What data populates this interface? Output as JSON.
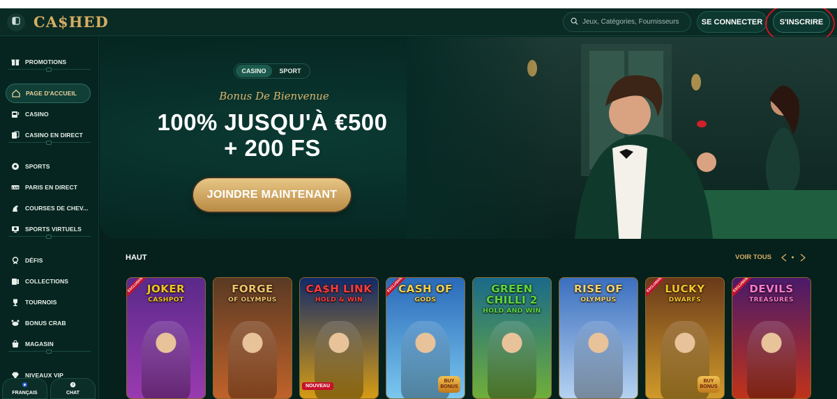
{
  "header": {
    "logo": "CA$HED",
    "search_placeholder": "Jeux, Catégories, Fournisseurs",
    "login_label": "SE CONNECTER",
    "register_label": "S'INSCRIRE"
  },
  "sidebar": {
    "items": [
      {
        "label": "PROMOTIONS",
        "icon": "gift-icon"
      },
      {
        "label": "PAGE D'ACCUEIL",
        "icon": "home-icon",
        "active": true
      },
      {
        "label": "CASINO",
        "icon": "slot-machine-icon"
      },
      {
        "label": "CASINO EN DIRECT",
        "icon": "live-cards-icon"
      },
      {
        "label": "SPORTS",
        "icon": "soccer-ball-icon"
      },
      {
        "label": "PARIS EN DIRECT",
        "icon": "live-icon"
      },
      {
        "label": "COURSES DE CHEV...",
        "icon": "horse-icon"
      },
      {
        "label": "SPORTS VIRTUELS",
        "icon": "virtual-sports-icon"
      },
      {
        "label": "DÉFIS",
        "icon": "challenge-icon"
      },
      {
        "label": "COLLECTIONS",
        "icon": "collections-icon"
      },
      {
        "label": "TOURNOIS",
        "icon": "trophy-icon"
      },
      {
        "label": "BONUS CRAB",
        "icon": "crab-icon"
      },
      {
        "label": "MAGASIN",
        "icon": "shop-icon"
      },
      {
        "label": "NIVEAUX VIP",
        "icon": "diamond-icon"
      }
    ],
    "language_label": "FRANÇAIS",
    "chat_label": "CHAT"
  },
  "hero": {
    "tab_casino": "CASINO",
    "tab_sport": "SPORT",
    "subtitle": "Bonus De Bienvenue",
    "title_line1": "100% JUSQU'À €500",
    "title_line2": "+ 200 FS",
    "cta_label": "JOINDRE MAINTENANT"
  },
  "games_section": {
    "title": "HAUT",
    "view_all": "VOIR TOUS",
    "games": [
      {
        "title": "JOKER",
        "subtitle": "CASHPOT",
        "badge": "EXCLUSIVE",
        "bg": "#5a2a8a",
        "bg2": "#9a3ab0",
        "title_color": "#f3c51e"
      },
      {
        "title": "FORGE",
        "subtitle": "OF OLYMPUS",
        "badge": "",
        "bg": "#5a3a24",
        "bg2": "#c0622a",
        "title_color": "#f0c36a"
      },
      {
        "title": "CA$H LINK",
        "subtitle": "HOLD & WIN",
        "badge": "NOUVEAU",
        "bg": "#122a6a",
        "bg2": "#d59b14",
        "title_color": "#ff3b3b"
      },
      {
        "title": "CASH OF",
        "subtitle": "GODS",
        "badge": "EXCLUSIVE",
        "bg": "#2a6ab8",
        "bg2": "#7ac7f0",
        "title_color": "#f5d04a",
        "bonus": "BUY BONUS"
      },
      {
        "title": "GREEN CHILLI 2",
        "subtitle": "HOLD AND WIN",
        "badge": "",
        "bg": "#1a6a8a",
        "bg2": "#6fae3a",
        "title_color": "#5fd63a"
      },
      {
        "title": "RISE OF",
        "subtitle": "OLYMPUS",
        "badge": "",
        "bg": "#3b6fbf",
        "bg2": "#b6d2f0",
        "title_color": "#f5d36a"
      },
      {
        "title": "LUCKY",
        "subtitle": "DWARFS",
        "badge": "EXCLUSIVE",
        "bg": "#6a3a1a",
        "bg2": "#d09a2a",
        "title_color": "#f5c32a",
        "bonus": "BUY BONUS"
      },
      {
        "title": "DEVILS",
        "subtitle": "TREASURES",
        "badge": "EXCLUSIVE",
        "bg": "#4a1a6a",
        "bg2": "#c0331a",
        "title_color": "#ff7ad0"
      }
    ]
  },
  "colors": {
    "background": "#06201b",
    "accent_gold": "#d6ae63",
    "highlight_ring": "#d4141f"
  }
}
